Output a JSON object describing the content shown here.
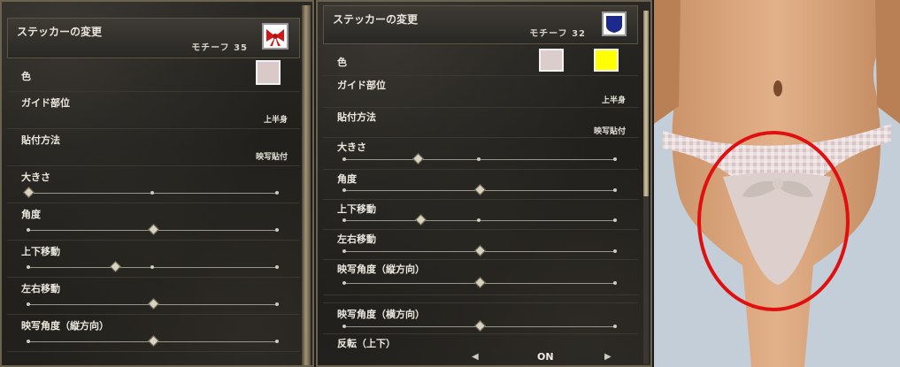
{
  "panel_a": {
    "title": "ステッカーの変更",
    "motif_label": "モチーフ 35",
    "motif_icon": "red-bow-icon",
    "rows": {
      "color": {
        "label": "色",
        "swatch": "#d9c9c9"
      },
      "guide": {
        "label": "ガイド部位",
        "value": "上半身"
      },
      "attach": {
        "label": "貼付方法",
        "value": "映写貼付"
      },
      "size": {
        "label": "大きさ",
        "level": 0.0
      },
      "angle": {
        "label": "角度",
        "level": 0.5
      },
      "vertical": {
        "label": "上下移動",
        "level": 0.35
      },
      "horizontal": {
        "label": "左右移動",
        "level": 0.5
      },
      "proj_v": {
        "label": "映写角度（縦方向）",
        "level": 0.5
      }
    }
  },
  "panel_b": {
    "title": "ステッカーの変更",
    "motif_label": "モチーフ 32",
    "motif_icon": "blue-shield-icon",
    "rows": {
      "color": {
        "label": "色",
        "swatch1": "#dccdcd",
        "swatch2": "#ffff00"
      },
      "guide": {
        "label": "ガイド部位",
        "value": "上半身"
      },
      "attach": {
        "label": "貼付方法",
        "value": "映写貼付"
      },
      "size": {
        "label": "大きさ",
        "level": 0.27
      },
      "angle": {
        "label": "角度",
        "level": 0.5
      },
      "vertical": {
        "label": "上下移動",
        "level": 0.28
      },
      "horizontal": {
        "label": "左右移動",
        "level": 0.5
      },
      "proj_v": {
        "label": "映写角度（縦方向）",
        "level": 0.5
      },
      "proj_h": {
        "label": "映写角度（横方向）",
        "level": 0.5
      },
      "flip_v": {
        "label": "反転（上下）",
        "value": "ON"
      }
    }
  },
  "colors": {
    "accent_circle": "#e01010"
  }
}
